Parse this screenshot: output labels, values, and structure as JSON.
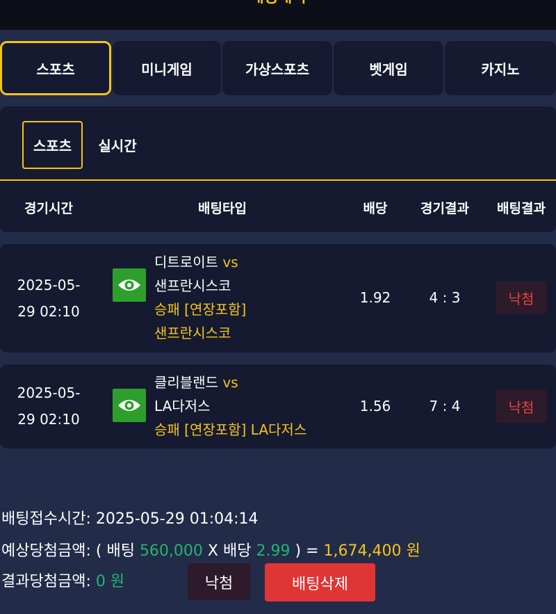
{
  "header": {
    "title": "배팅내역"
  },
  "tabs": [
    "스포츠",
    "미니게임",
    "가상스포츠",
    "벳게임",
    "카지노"
  ],
  "subtabs": [
    "스포츠",
    "실시간"
  ],
  "table_headers": {
    "time": "경기시간",
    "type": "배팅타입",
    "odds": "배당",
    "score": "경기결과",
    "result": "배팅결과"
  },
  "bets": [
    {
      "date": "2025-05-",
      "time": "29 02:10",
      "home": "디트로이트",
      "vs": "vs",
      "away": "샌프란시스코",
      "market": "승패 [연장포함]",
      "pick": "샌프란시스코",
      "odds": "1.92",
      "score": "4 : 3",
      "result": "낙첨"
    },
    {
      "date": "2025-05-",
      "time": "29 02:10",
      "home": "클리블랜드",
      "vs": "vs",
      "away": "LA다저스",
      "market": "승패 [연장포함]",
      "pick": "LA다저스",
      "odds": "1.56",
      "score": "7 : 4",
      "result": "낙첨"
    }
  ],
  "summary": {
    "received_label": "배팅접수시간:",
    "received_value": "2025-05-29 01:04:14",
    "expected_label": "예상당첨금액:",
    "open_paren": "(",
    "bet_label": "배팅",
    "bet_amount": "560,000",
    "times": "X",
    "odds_label": "배당",
    "total_odds": "2.99",
    "close_paren": ")",
    "equals": "=",
    "expected_amount": "1,674,400 원",
    "result_label": "결과당첨금액:",
    "result_amount": "0 원"
  },
  "buttons": {
    "status": "낙첨",
    "delete": "배팅삭제"
  },
  "colors": {
    "accent": "#f5c518",
    "win_green": "#22b573",
    "lose_red": "#e0473f",
    "delete_red": "#e03535"
  },
  "icons": {
    "view": "eye-icon"
  }
}
